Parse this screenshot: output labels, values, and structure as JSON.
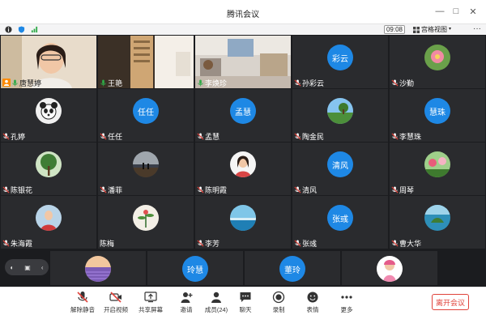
{
  "window": {
    "title": "腾讯会议",
    "controls": [
      "—",
      "□",
      "✕"
    ]
  },
  "status": {
    "timer": "09:08",
    "view_label": "宫格视图",
    "more": "···"
  },
  "participants": [
    {
      "name": "唐慧婷",
      "kind": "video",
      "mic": "on",
      "label_color": "#ff8a00"
    },
    {
      "name": "王艳",
      "kind": "video",
      "mic": "on"
    },
    {
      "name": "李焕珍",
      "kind": "video",
      "mic": "on"
    },
    {
      "name": "孙彩云",
      "kind": "letters",
      "letters": "彩云",
      "mic": "off"
    },
    {
      "name": "沙勤",
      "kind": "photo",
      "photo": "flower",
      "mic": "off"
    },
    {
      "name": "孔婷",
      "kind": "photo",
      "photo": "panda",
      "mic": "off"
    },
    {
      "name": "任任",
      "kind": "letters",
      "letters": "任任",
      "mic": "off"
    },
    {
      "name": "孟慧",
      "kind": "letters",
      "letters": "孟慧",
      "mic": "off"
    },
    {
      "name": "陶金民",
      "kind": "photo",
      "photo": "landscape",
      "mic": "off"
    },
    {
      "name": "李慧珠",
      "kind": "letters",
      "letters": "慧珠",
      "mic": "off"
    },
    {
      "name": "陈银花",
      "kind": "photo",
      "photo": "tree",
      "mic": "off"
    },
    {
      "name": "潘菲",
      "kind": "photo",
      "photo": "sunset",
      "mic": "off"
    },
    {
      "name": "陈明霞",
      "kind": "photo",
      "photo": "woman",
      "mic": "off"
    },
    {
      "name": "清风",
      "kind": "letters",
      "letters": "清风",
      "mic": "off"
    },
    {
      "name": "周琴",
      "kind": "photo",
      "photo": "garden",
      "mic": "off"
    },
    {
      "name": "朱海霞",
      "kind": "photo",
      "photo": "person-red",
      "mic": "off"
    },
    {
      "name": "陈梅",
      "kind": "photo",
      "photo": "plant-drawing",
      "mic": "none"
    },
    {
      "name": "李芳",
      "kind": "photo",
      "photo": "sea",
      "mic": "off"
    },
    {
      "name": "张彧",
      "kind": "letters",
      "letters": "张彧",
      "mic": "off"
    },
    {
      "name": "曹大华",
      "kind": "photo",
      "photo": "island",
      "mic": "off"
    }
  ],
  "strip": {
    "controls": [
      "◐",
      "▣",
      "‹"
    ],
    "tiles": [
      {
        "kind": "photo",
        "photo": "lavender"
      },
      {
        "kind": "letters",
        "letters": "玲慧"
      },
      {
        "kind": "letters",
        "letters": "董玲"
      },
      {
        "kind": "photo",
        "photo": "cartoon"
      }
    ]
  },
  "toolbar": {
    "items": [
      {
        "label": "解除静音",
        "icon": "mic-muted-icon"
      },
      {
        "label": "开启视频",
        "icon": "camera-off-icon"
      },
      {
        "label": "共享屏幕",
        "icon": "share-screen-icon"
      },
      {
        "label": "邀请",
        "icon": "invite-icon"
      },
      {
        "label": "成员(24)",
        "icon": "members-icon"
      },
      {
        "label": "聊天",
        "icon": "chat-icon"
      },
      {
        "label": "录制",
        "icon": "record-icon"
      },
      {
        "label": "表情",
        "icon": "emoji-icon"
      },
      {
        "label": "更多",
        "icon": "more-icon"
      }
    ],
    "end_label": "离开会议"
  },
  "colors": {
    "avatar_blue": "#1e88e5",
    "end_red": "#e0433b",
    "tile_bg": "#2a2b2e"
  }
}
